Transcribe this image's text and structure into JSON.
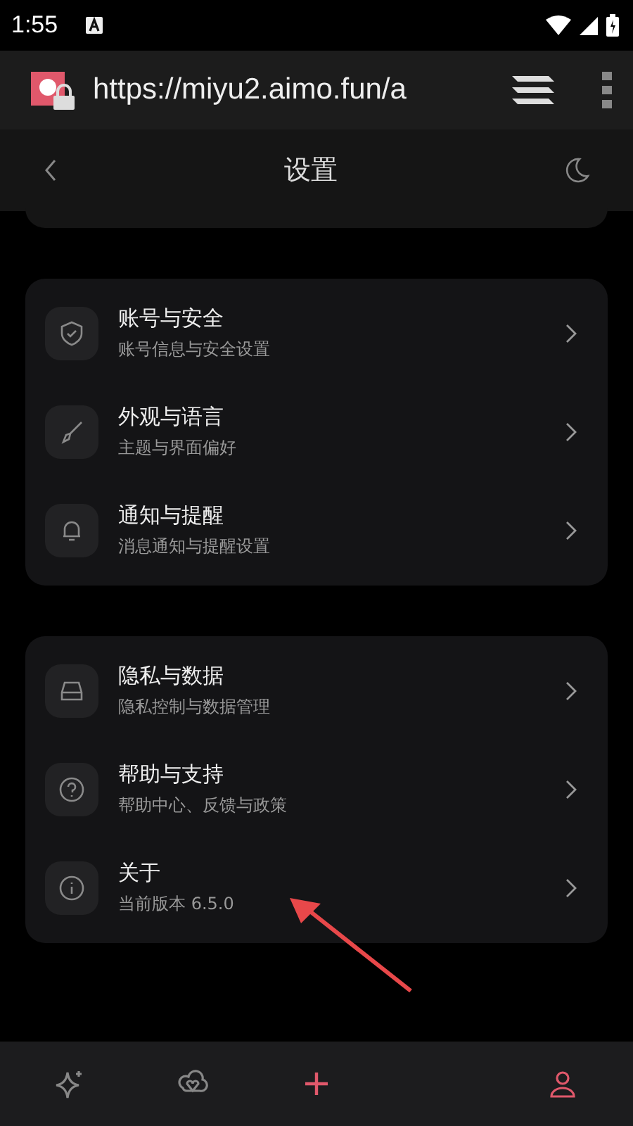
{
  "status_bar": {
    "time": "1:55"
  },
  "browser": {
    "url": "https://miyu2.aimo.fun/a"
  },
  "header": {
    "title": "设置"
  },
  "groups": [
    {
      "items": [
        {
          "title": "账号与安全",
          "subtitle": "账号信息与安全设置"
        },
        {
          "title": "外观与语言",
          "subtitle": "主题与界面偏好"
        },
        {
          "title": "通知与提醒",
          "subtitle": "消息通知与提醒设置"
        }
      ]
    },
    {
      "items": [
        {
          "title": "隐私与数据",
          "subtitle": "隐私控制与数据管理"
        },
        {
          "title": "帮助与支持",
          "subtitle": "帮助中心、反馈与政策"
        },
        {
          "title": "关于",
          "subtitle": "当前版本 6.5.0"
        }
      ]
    }
  ],
  "bottom_nav": [
    {
      "kind": "sparkle",
      "selected": false
    },
    {
      "kind": "hearts",
      "selected": false
    },
    {
      "kind": "add"
    },
    {
      "kind": "person",
      "selected": true
    }
  ]
}
